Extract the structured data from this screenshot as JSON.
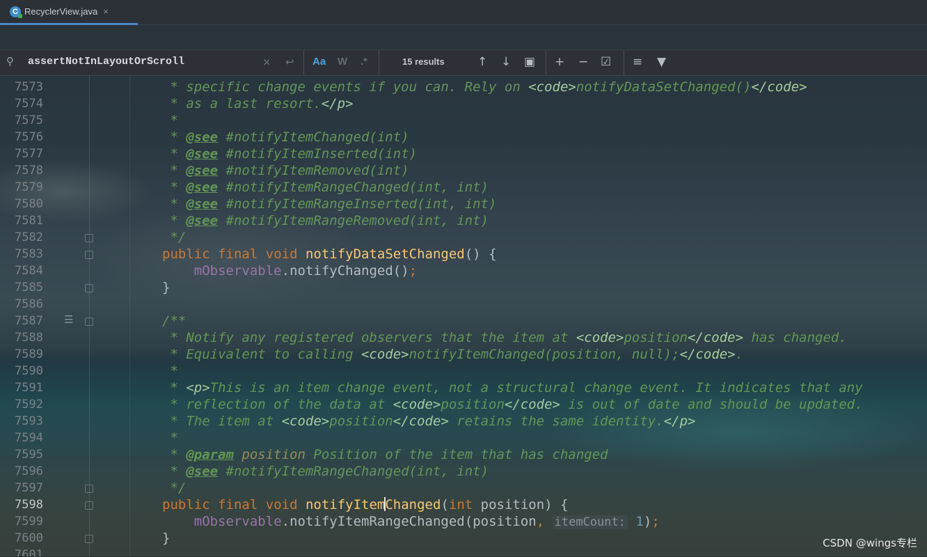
{
  "tab": {
    "icon": "java-class-icon",
    "icon_letter": "C",
    "label": "RecyclerView.java",
    "close": "×"
  },
  "search": {
    "icon": "search-icon",
    "query": "assertNotInLayoutOrScroll",
    "clear": "×",
    "newline": "↩",
    "match_case": "Aa",
    "words": "W",
    "regex": ".*",
    "results": "15 results"
  },
  "toolbar": {
    "prev": "↑",
    "next": "↓",
    "open_in_window": "▣",
    "add_occurrence": "+",
    "remove_occurrence": "−",
    "select_all": "☑",
    "in_selection": "≡",
    "filter": "▼"
  },
  "colors": {
    "keyword": "#cc7832",
    "function": "#ffc66d",
    "comment": "#629755",
    "field": "#9876aa",
    "number": "#6897bb"
  },
  "editor": {
    "current_line": "7598",
    "lines": [
      {
        "n": "7573",
        "t": " * specific change events if you can. Rely on <code>notifyDataSetChanged()</code>"
      },
      {
        "n": "7574",
        "t": " * as a last resort.</p>"
      },
      {
        "n": "7575",
        "t": " *"
      },
      {
        "n": "7576",
        "t": " * @see #notifyItemChanged(int)"
      },
      {
        "n": "7577",
        "t": " * @see #notifyItemInserted(int)"
      },
      {
        "n": "7578",
        "t": " * @see #notifyItemRemoved(int)"
      },
      {
        "n": "7579",
        "t": " * @see #notifyItemRangeChanged(int, int)"
      },
      {
        "n": "7580",
        "t": " * @see #notifyItemRangeInserted(int, int)"
      },
      {
        "n": "7581",
        "t": " * @see #notifyItemRangeRemoved(int, int)"
      },
      {
        "n": "7582",
        "t": " */"
      },
      {
        "n": "7583",
        "t": "public final void notifyDataSetChanged() {"
      },
      {
        "n": "7584",
        "t": "    mObservable.notifyChanged();"
      },
      {
        "n": "7585",
        "t": "}"
      },
      {
        "n": "7586",
        "t": ""
      },
      {
        "n": "7587",
        "t": "/**"
      },
      {
        "n": "7588",
        "t": " * Notify any registered observers that the item at <code>position</code> has changed."
      },
      {
        "n": "7589",
        "t": " * Equivalent to calling <code>notifyItemChanged(position, null);</code>."
      },
      {
        "n": "7590",
        "t": " *"
      },
      {
        "n": "7591",
        "t": " * <p>This is an item change event, not a structural change event. It indicates that any"
      },
      {
        "n": "7592",
        "t": " * reflection of the data at <code>position</code> is out of date and should be updated."
      },
      {
        "n": "7593",
        "t": " * The item at <code>position</code> retains the same identity.</p>"
      },
      {
        "n": "7594",
        "t": " *"
      },
      {
        "n": "7595",
        "t": " * @param position Position of the item that has changed"
      },
      {
        "n": "7596",
        "t": " * @see #notifyItemRangeChanged(int, int)"
      },
      {
        "n": "7597",
        "t": " */"
      },
      {
        "n": "7598",
        "t": "public final void notifyItemChanged(int position) {"
      },
      {
        "n": "7599",
        "t": "    mObservable.notifyItemRangeChanged(position, itemCount: 1);"
      },
      {
        "n": "7600",
        "t": "}"
      },
      {
        "n": "7601",
        "t": ""
      }
    ]
  },
  "watermark": "CSDN @wings专栏"
}
